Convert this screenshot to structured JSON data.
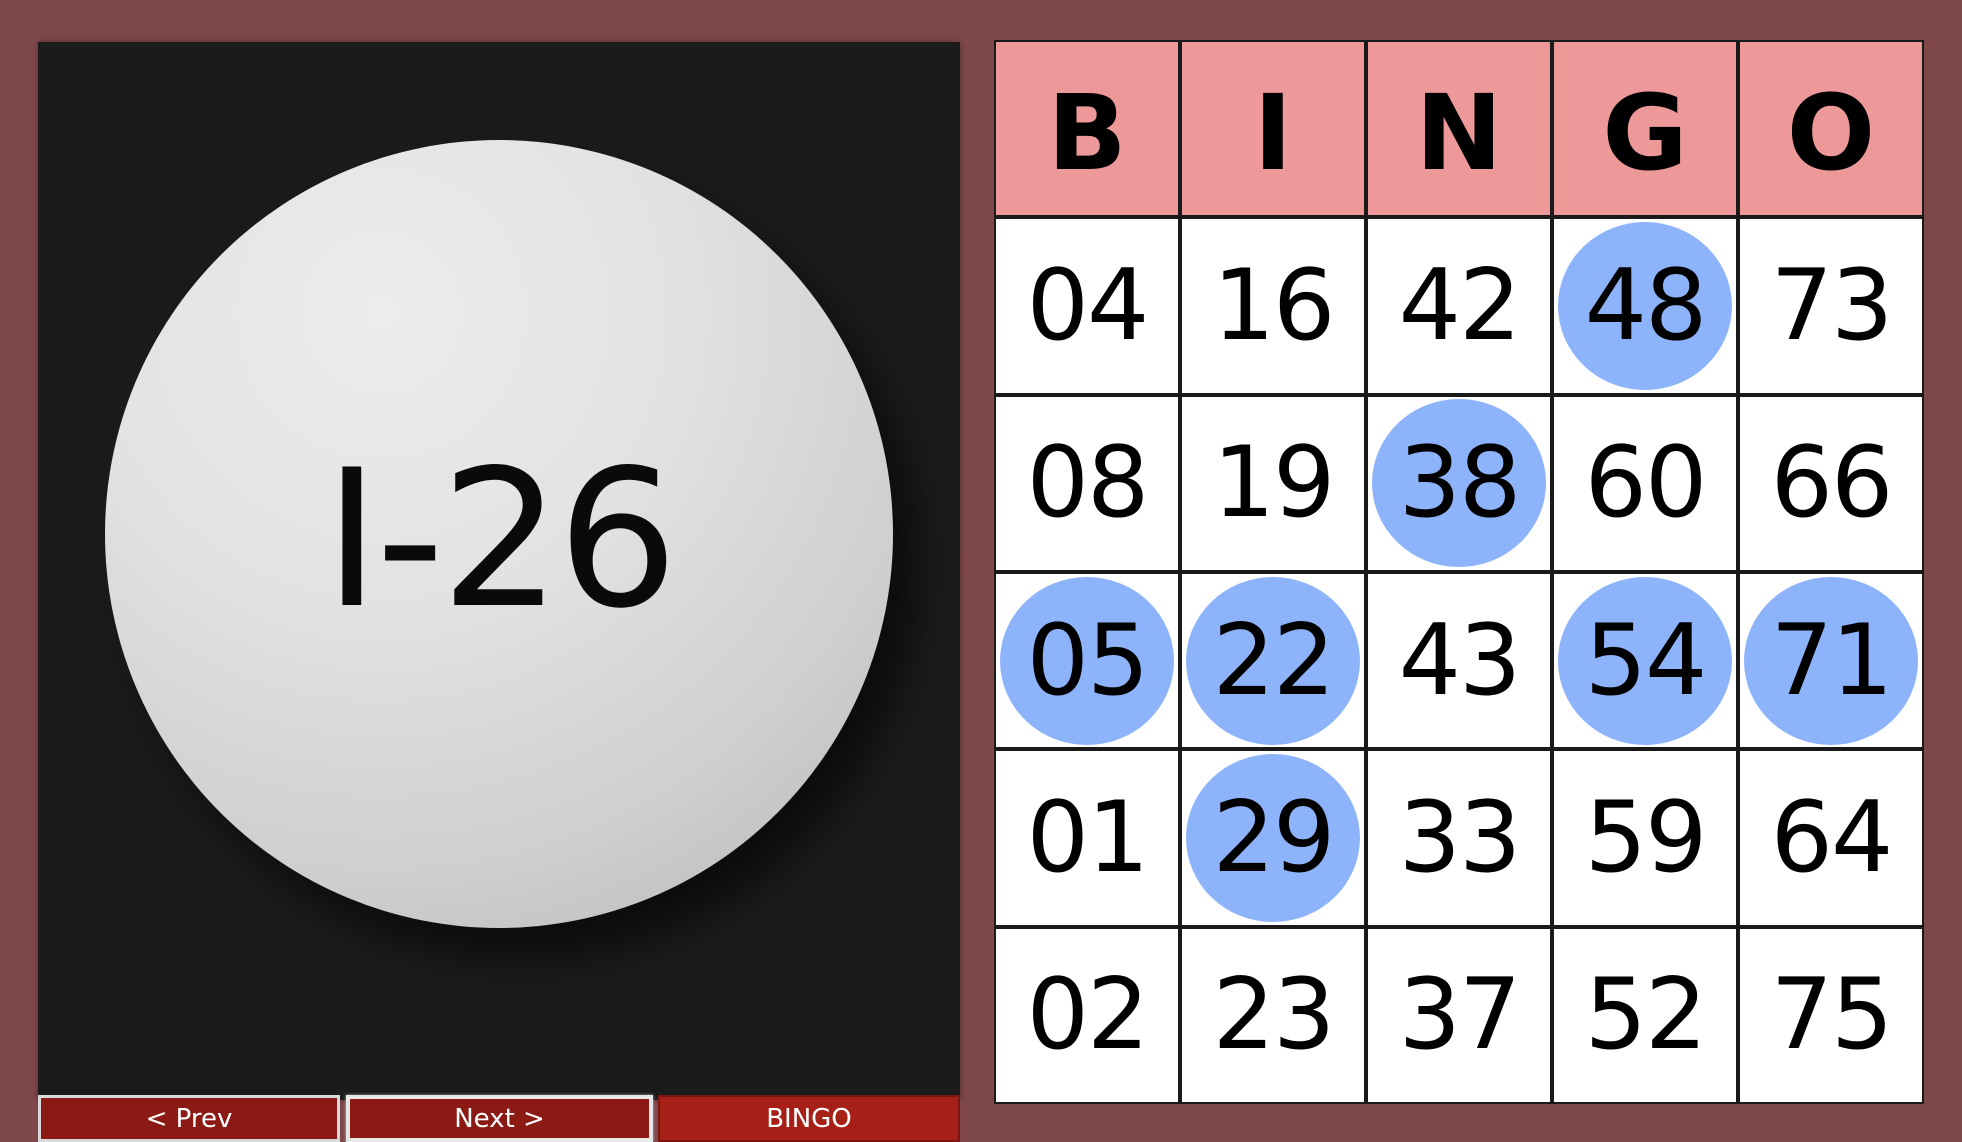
{
  "current_ball": "I-26",
  "controls": {
    "prev_label": "< Prev",
    "next_label": "Next >",
    "bingo_label": "BINGO"
  },
  "card": {
    "headers": [
      "B",
      "I",
      "N",
      "G",
      "O"
    ],
    "rows": [
      [
        "04",
        "16",
        "42",
        "48",
        "73"
      ],
      [
        "08",
        "19",
        "38",
        "60",
        "66"
      ],
      [
        "05",
        "22",
        "43",
        "54",
        "71"
      ],
      [
        "01",
        "29",
        "33",
        "59",
        "64"
      ],
      [
        "02",
        "23",
        "37",
        "52",
        "75"
      ]
    ],
    "marked": [
      [
        false,
        false,
        false,
        true,
        false
      ],
      [
        false,
        false,
        true,
        false,
        false
      ],
      [
        true,
        true,
        false,
        true,
        true
      ],
      [
        false,
        true,
        false,
        false,
        false
      ],
      [
        false,
        false,
        false,
        false,
        false
      ]
    ]
  },
  "colors": {
    "background": "#7e474a",
    "panel": "#1b1b1b",
    "header": "#ee9999",
    "mark": "#8db4fb",
    "button": "#8c1a14",
    "bingo_button": "#a72018"
  }
}
